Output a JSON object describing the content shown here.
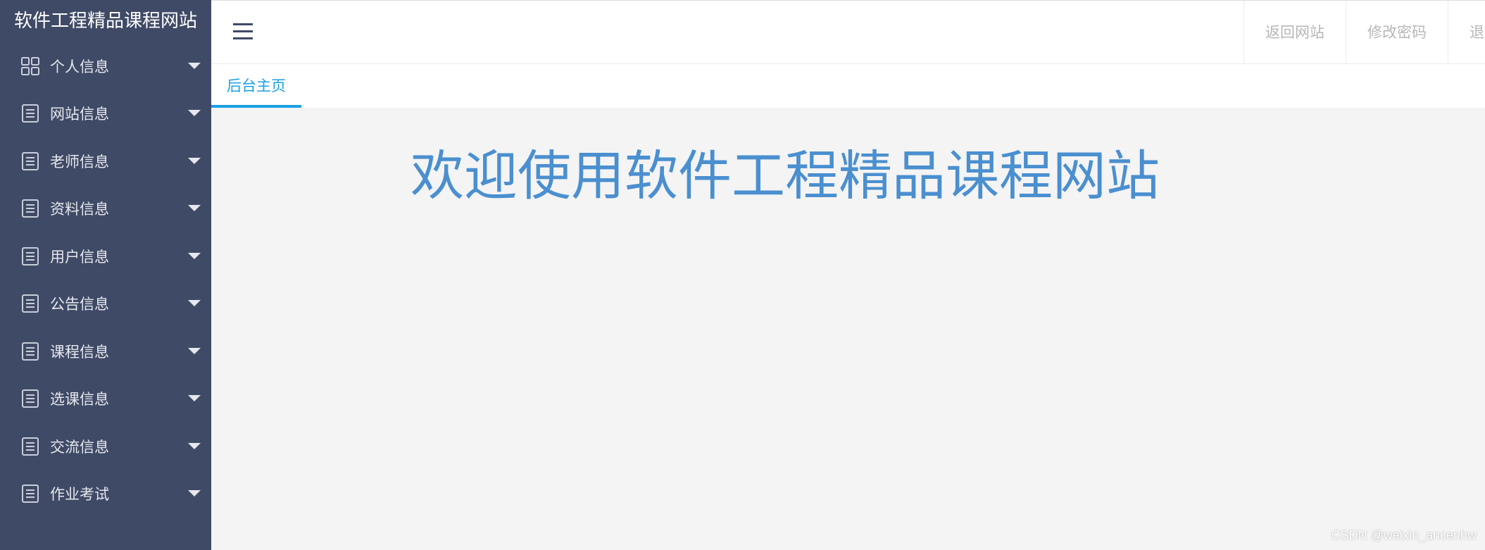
{
  "sidebar": {
    "logo": "软件工程精品课程网站",
    "items": [
      {
        "label": "个人信息",
        "icon": "grid-icon"
      },
      {
        "label": "网站信息",
        "icon": "document-icon"
      },
      {
        "label": "老师信息",
        "icon": "document-icon"
      },
      {
        "label": "资料信息",
        "icon": "document-icon"
      },
      {
        "label": "用户信息",
        "icon": "document-icon"
      },
      {
        "label": "公告信息",
        "icon": "document-icon"
      },
      {
        "label": "课程信息",
        "icon": "document-icon"
      },
      {
        "label": "选课信息",
        "icon": "document-icon"
      },
      {
        "label": "交流信息",
        "icon": "document-icon"
      },
      {
        "label": "作业考试",
        "icon": "document-icon"
      }
    ]
  },
  "header": {
    "menu_icon": "hamburger-icon",
    "actions": [
      "返回网站",
      "修改密码",
      "退"
    ]
  },
  "tabs": [
    {
      "label": "后台主页",
      "active": true
    }
  ],
  "main": {
    "welcome": "欢迎使用软件工程精品课程网站"
  },
  "watermark": "CSDN @weixin_ancenhw",
  "colors": {
    "sidebar_bg": "#3f4a66",
    "accent": "#1aa0e6",
    "welcome": "#4a8fd0",
    "content_bg": "#f4f4f4"
  }
}
